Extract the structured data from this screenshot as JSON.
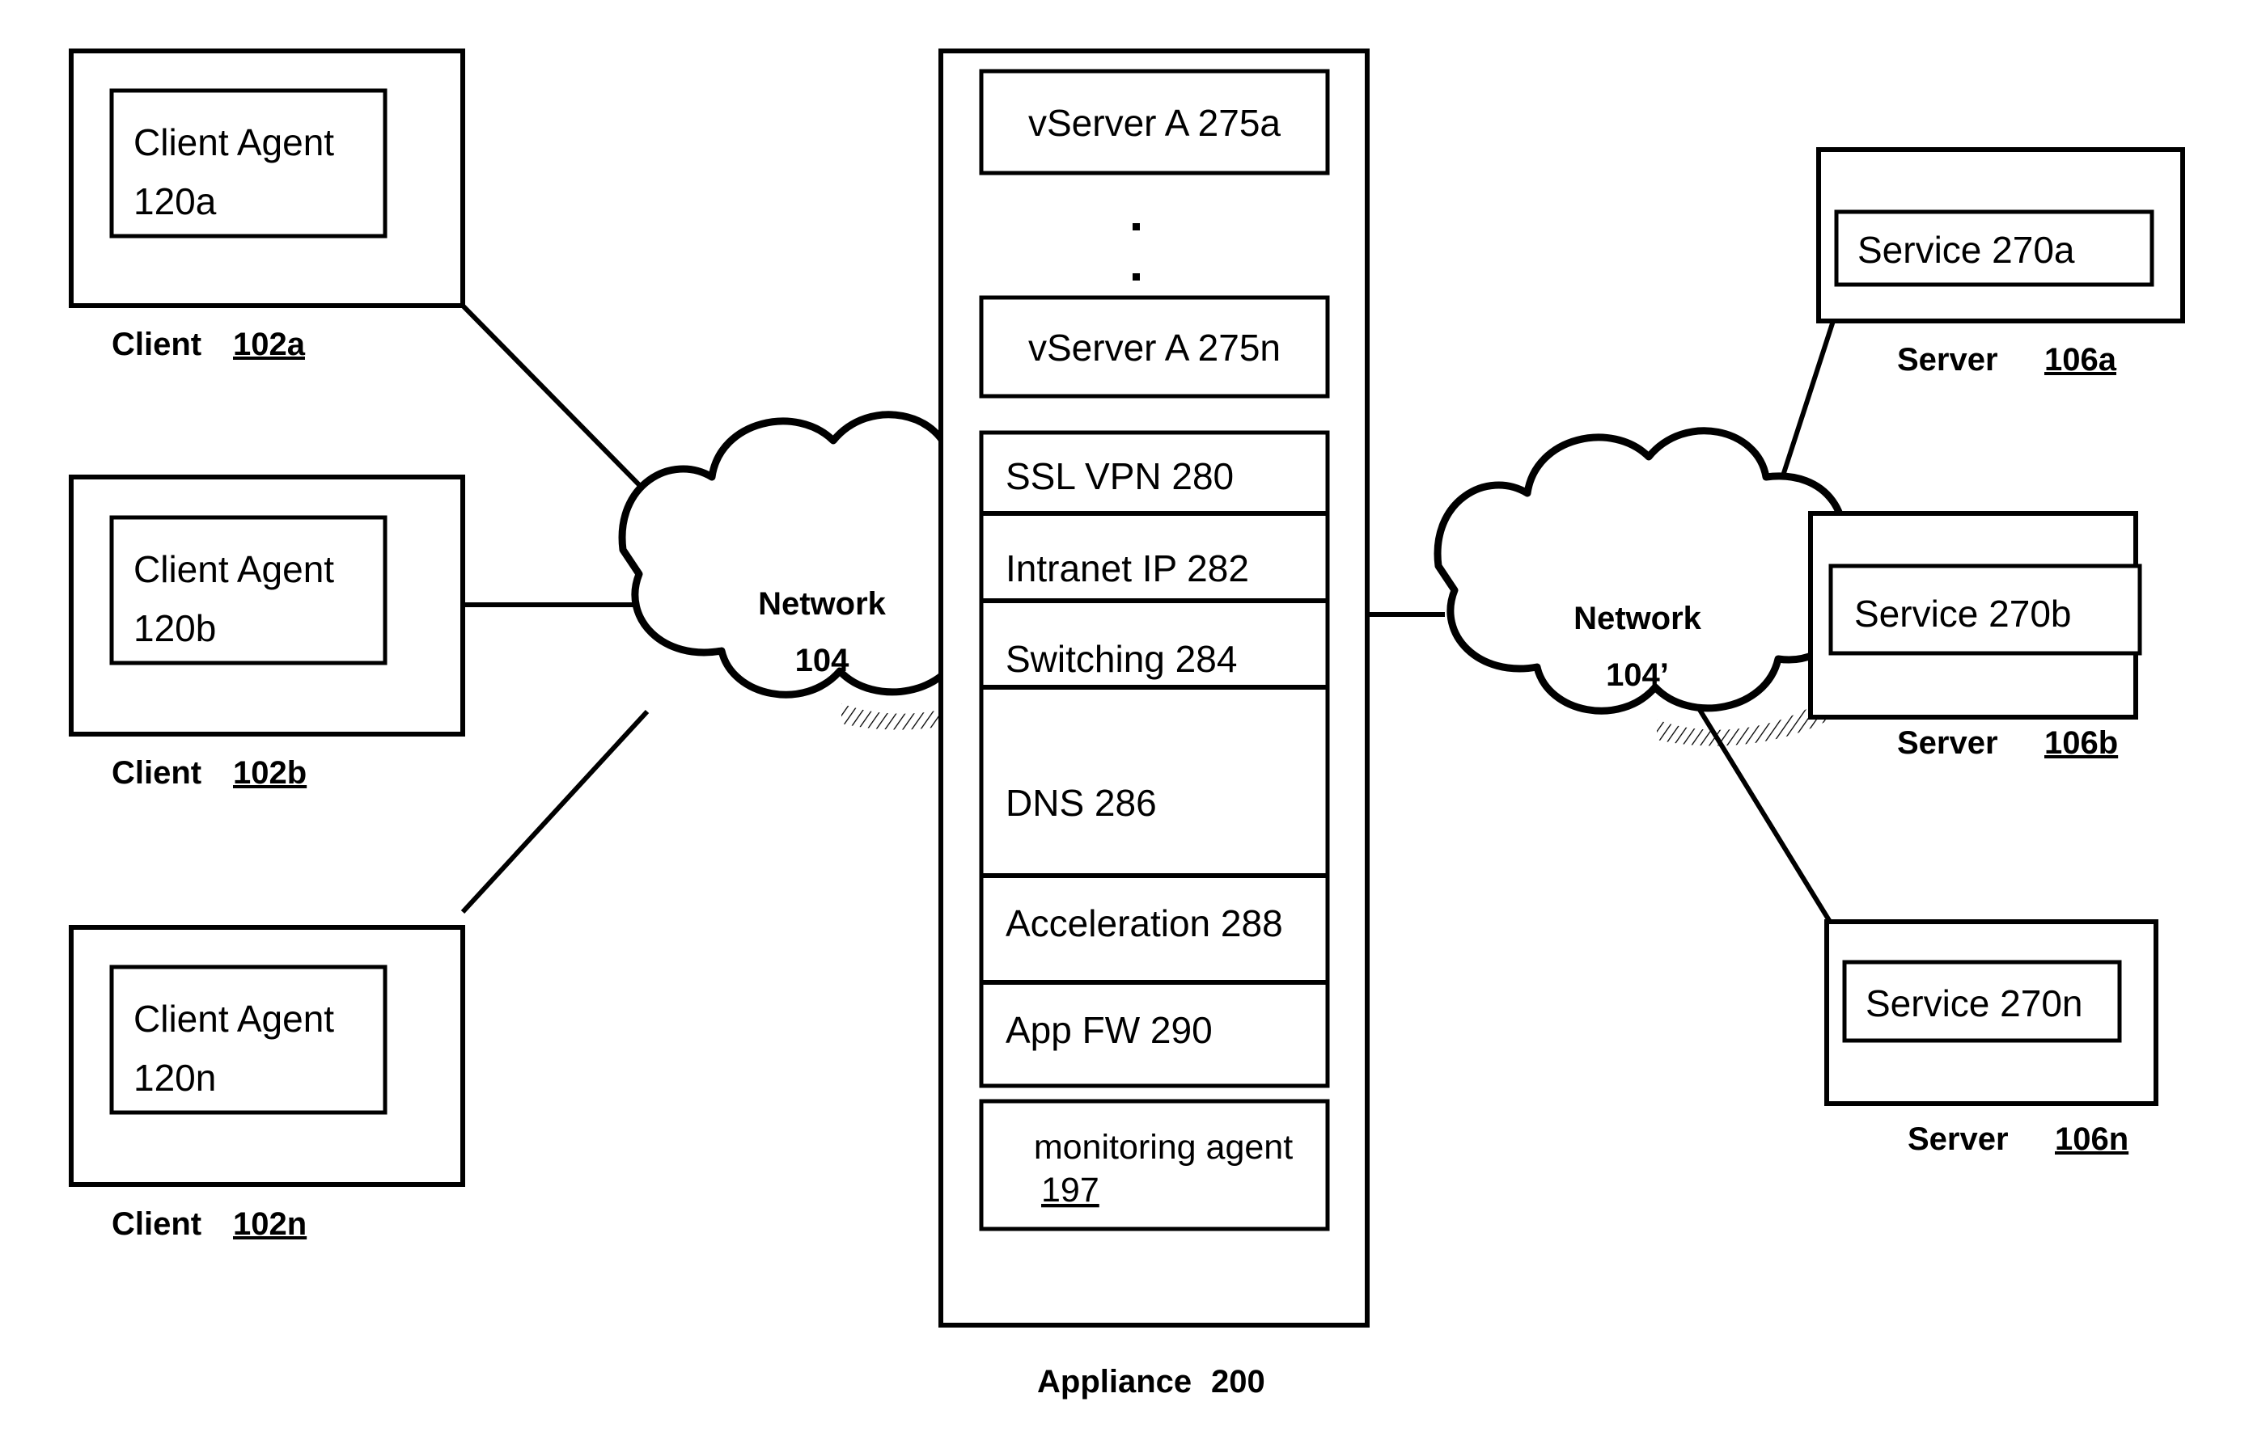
{
  "figure": {
    "kind": "network-architecture-diagram",
    "background_color": "#ffffff",
    "line_color": "#000000"
  },
  "clients": [
    {
      "agent_label": "Client Agent",
      "agent_number": "120a",
      "caption_label": "Client",
      "caption_number": "102a"
    },
    {
      "agent_label": "Client Agent",
      "agent_number": "120b",
      "caption_label": "Client",
      "caption_number": "102b"
    },
    {
      "agent_label": "Client Agent",
      "agent_number": "120n",
      "caption_label": "Client",
      "caption_number": "102n"
    }
  ],
  "networks": [
    {
      "name": "Network",
      "number": "104"
    },
    {
      "name": "Network",
      "number": "104’"
    }
  ],
  "appliance": {
    "caption_label": "Appliance",
    "caption_number": "200",
    "vservers": [
      {
        "label": "vServer A 275a"
      },
      {
        "label": "vServer A 275n"
      }
    ],
    "ellipsis": "·",
    "features": [
      {
        "label": "SSL VPN 280"
      },
      {
        "label": "Intranet IP 282"
      },
      {
        "label": "Switching 284"
      },
      {
        "label": "DNS 286"
      },
      {
        "label": "Acceleration 288"
      },
      {
        "label": "App FW 290"
      }
    ],
    "monitoring_agent": {
      "label": "monitoring agent",
      "number": "197"
    }
  },
  "servers": [
    {
      "service_label": "Service 270a",
      "caption_label": "Server",
      "caption_number": "106a"
    },
    {
      "service_label": "Service 270b",
      "caption_label": "Server",
      "caption_number": "106b"
    },
    {
      "service_label": "Service 270n",
      "caption_label": "Server",
      "caption_number": "106n"
    }
  ]
}
